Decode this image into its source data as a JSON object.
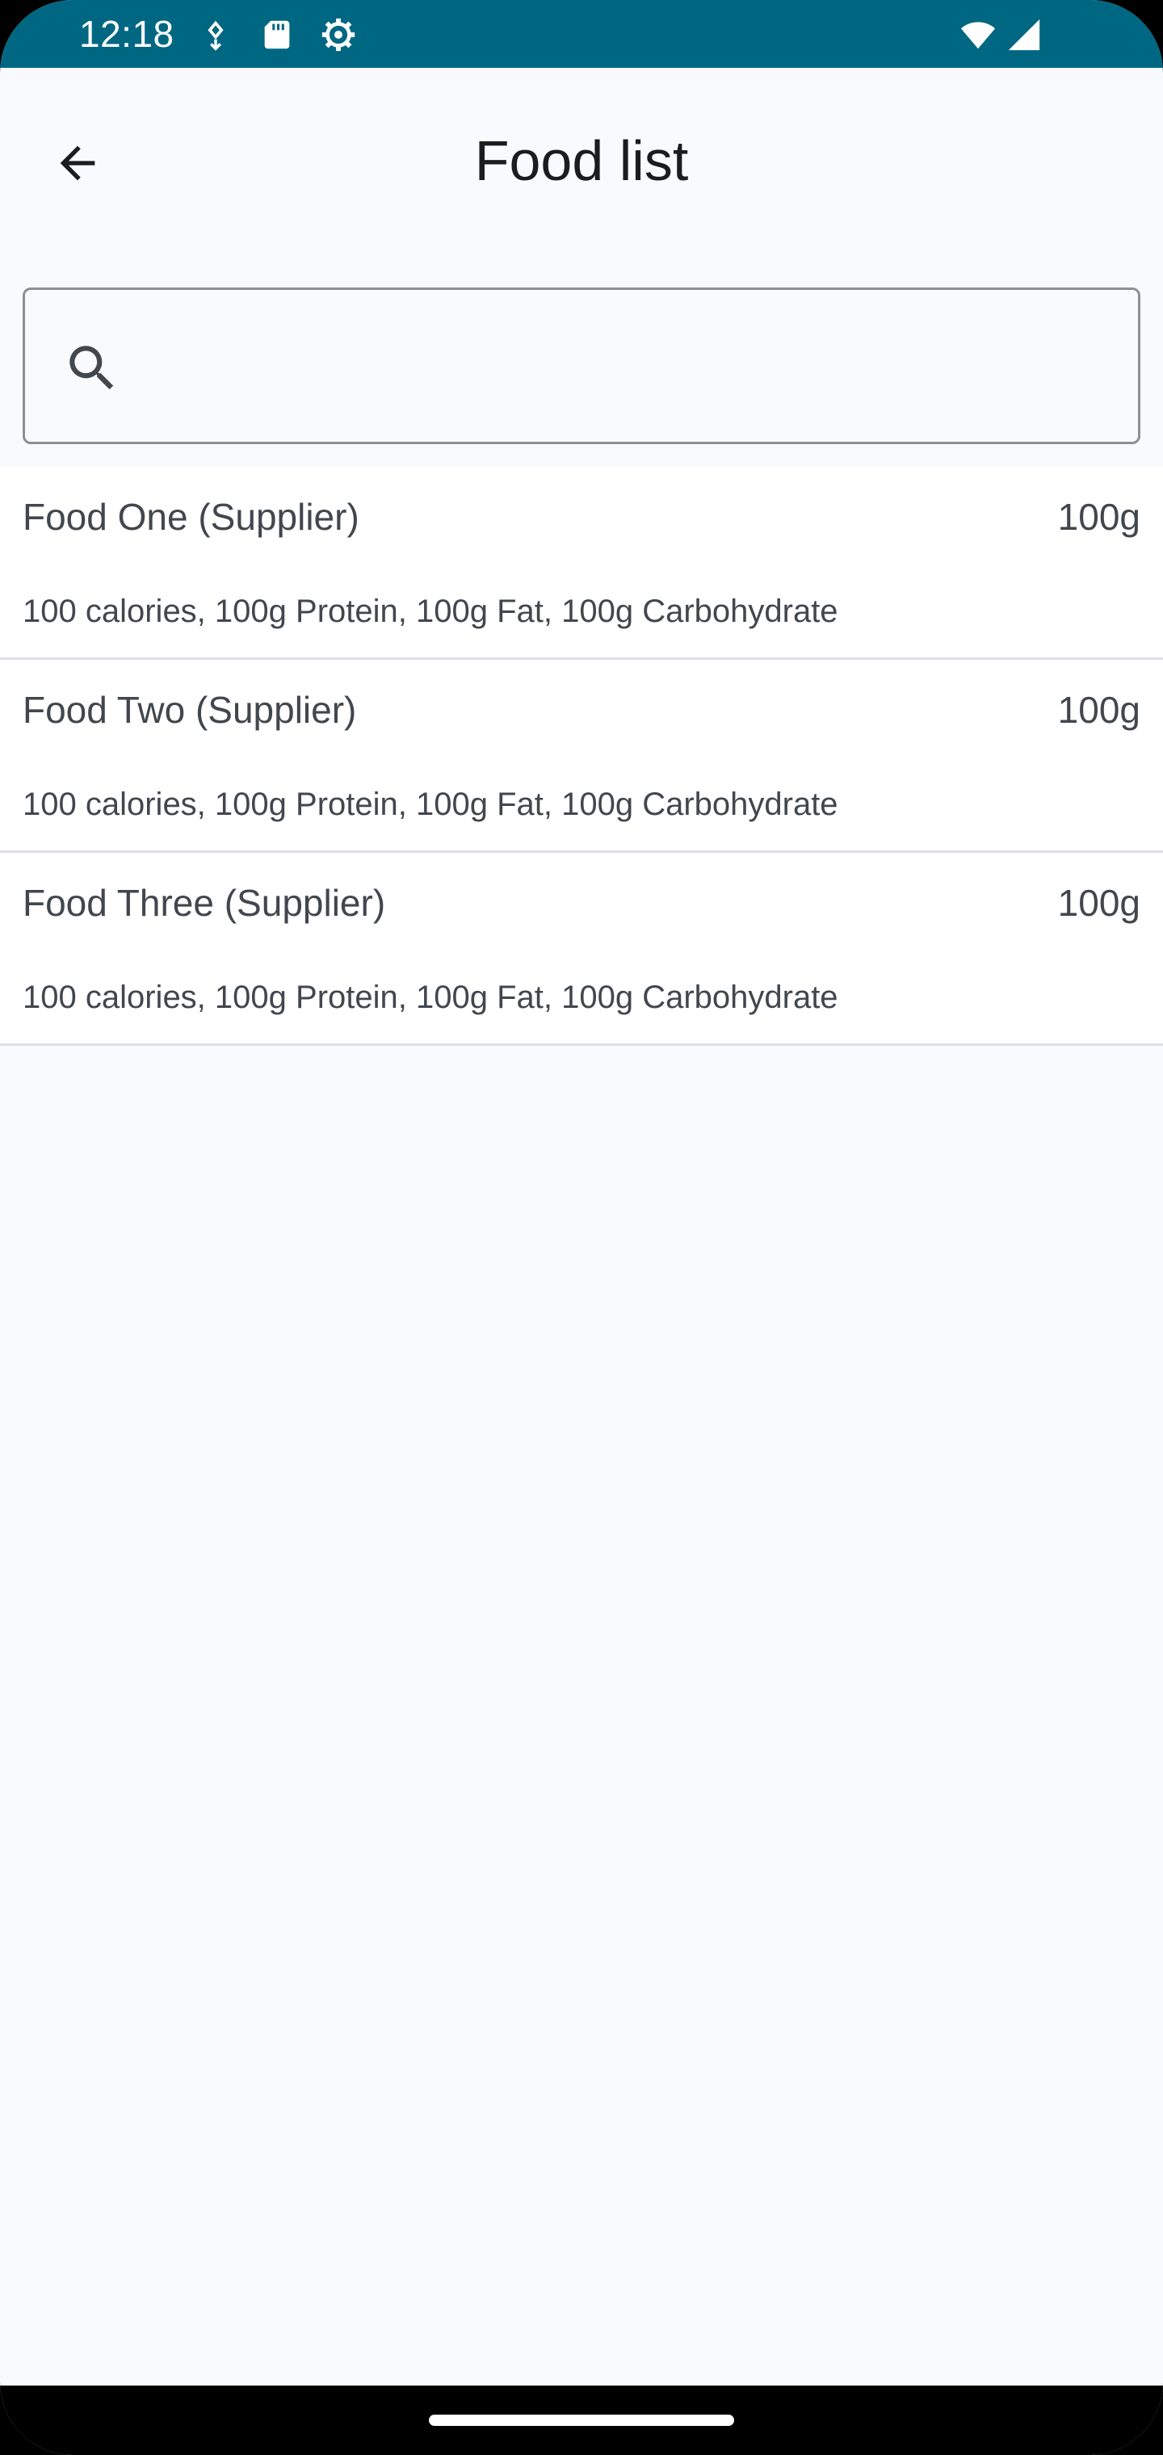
{
  "status_bar": {
    "time": "12:18",
    "background_color": "#006783",
    "icons": [
      "data-saver-icon",
      "sd-card-icon",
      "settings-gear-icon",
      "wifi-icon",
      "signal-icon"
    ]
  },
  "app_bar": {
    "back_icon": "arrow-back-icon",
    "title": "Food list"
  },
  "search": {
    "icon": "search-icon",
    "value": "",
    "placeholder": ""
  },
  "foods": [
    {
      "name": "Food One (Supplier)",
      "weight": "100g",
      "details": "100 calories, 100g Protein, 100g Fat, 100g Carbohydrate"
    },
    {
      "name": "Food Two (Supplier)",
      "weight": "100g",
      "details": "100 calories, 100g Protein, 100g Fat, 100g Carbohydrate"
    },
    {
      "name": "Food Three (Supplier)",
      "weight": "100g",
      "details": "100 calories, 100g Protein, 100g Fat, 100g Carbohydrate"
    }
  ],
  "colors": {
    "background": "#f9fafd",
    "list_item_background": "#ffffff",
    "text_primary": "#1a1c1e",
    "text_secondary": "#42474e",
    "divider": "#dcdfe3"
  }
}
